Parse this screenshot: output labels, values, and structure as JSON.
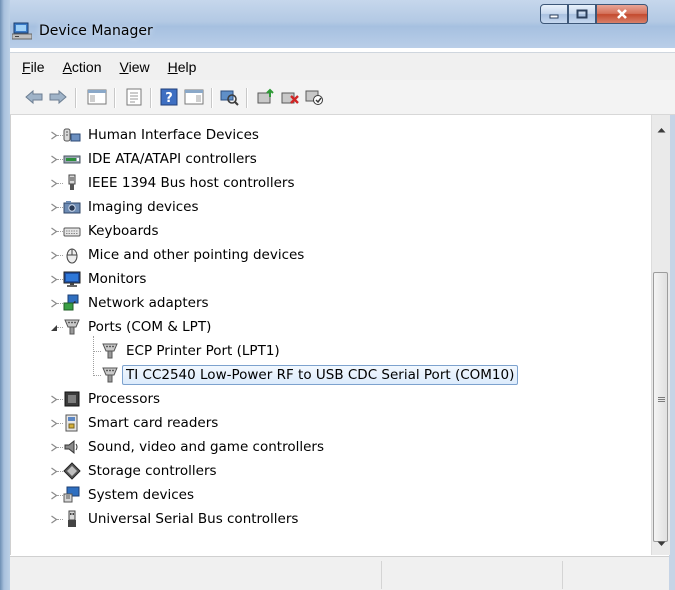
{
  "window": {
    "title": "Device Manager"
  },
  "menu": [
    "File",
    "Action",
    "View",
    "Help"
  ],
  "toolbar_icons": [
    "back-arrow-icon",
    "forward-arrow-icon",
    "show-hide-console-tree-icon",
    "properties-icon",
    "help-icon",
    "action-pane-icon",
    "scan-hardware-icon",
    "update-driver-icon",
    "uninstall-icon",
    "disable-icon"
  ],
  "tree": [
    {
      "label": "Human Interface Devices",
      "icon": "hid-icon",
      "level": 1,
      "expanded": false
    },
    {
      "label": "IDE ATA/ATAPI controllers",
      "icon": "ide-controller-icon",
      "level": 1,
      "expanded": false
    },
    {
      "label": "IEEE 1394 Bus host controllers",
      "icon": "ieee1394-icon",
      "level": 1,
      "expanded": false
    },
    {
      "label": "Imaging devices",
      "icon": "camera-icon",
      "level": 1,
      "expanded": false
    },
    {
      "label": "Keyboards",
      "icon": "keyboard-icon",
      "level": 1,
      "expanded": false
    },
    {
      "label": "Mice and other pointing devices",
      "icon": "mouse-icon",
      "level": 1,
      "expanded": false
    },
    {
      "label": "Monitors",
      "icon": "monitor-icon",
      "level": 1,
      "expanded": false
    },
    {
      "label": "Network adapters",
      "icon": "network-adapter-icon",
      "level": 1,
      "expanded": false
    },
    {
      "label": "Ports (COM & LPT)",
      "icon": "port-icon",
      "level": 1,
      "expanded": true
    },
    {
      "label": "ECP Printer Port (LPT1)",
      "icon": "port-icon",
      "level": 2
    },
    {
      "label": "TI CC2540 Low-Power RF to USB CDC Serial Port (COM10)",
      "icon": "port-icon",
      "level": 2,
      "selected": true
    },
    {
      "label": "Processors",
      "icon": "processor-icon",
      "level": 1,
      "expanded": false
    },
    {
      "label": "Smart card readers",
      "icon": "smart-card-icon",
      "level": 1,
      "expanded": false
    },
    {
      "label": "Sound, video and game controllers",
      "icon": "speaker-icon",
      "level": 1,
      "expanded": false
    },
    {
      "label": "Storage controllers",
      "icon": "storage-icon",
      "level": 1,
      "expanded": false
    },
    {
      "label": "System devices",
      "icon": "system-devices-icon",
      "level": 1,
      "expanded": false
    },
    {
      "label": "Universal Serial Bus controllers",
      "icon": "usb-icon",
      "level": 1,
      "expanded": false
    }
  ],
  "status": [
    "",
    "",
    ""
  ]
}
